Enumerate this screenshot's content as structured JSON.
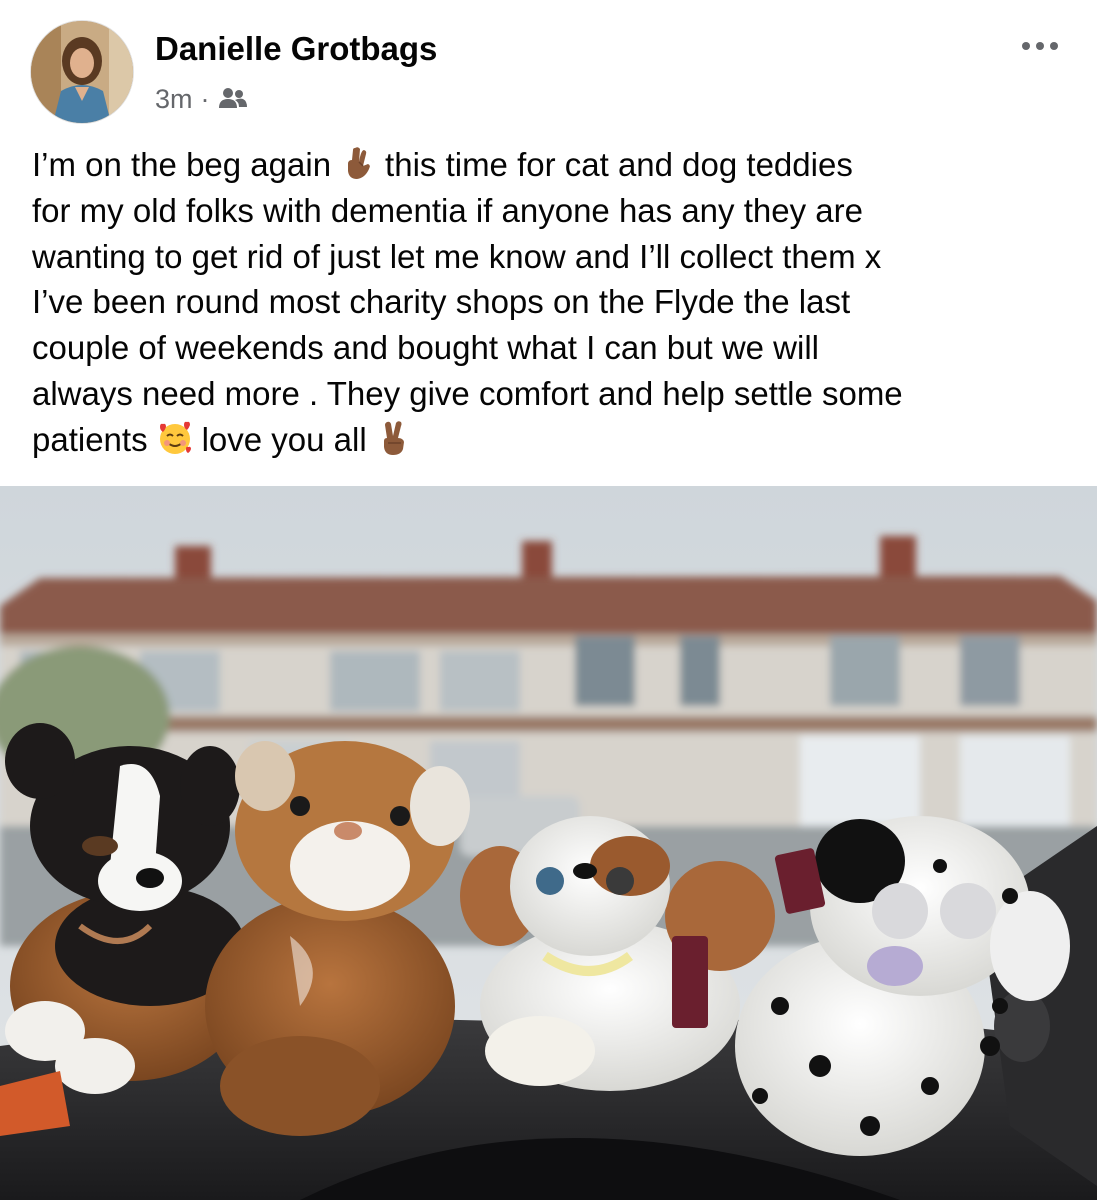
{
  "post": {
    "author": "Danielle Grotbags",
    "time": "3m",
    "separator": "·",
    "audience_icon": "friends-icon",
    "more_icon": "more-options-icon",
    "text": {
      "line1_a": "I’m on the beg again",
      "line1_b": "this time for cat and dog teddies",
      "line2": "for my old folks with dementia if anyone has any they are",
      "line3": "wanting to get rid of just let me know and I’ll collect them x",
      "line4": "I’ve been round most charity shops on the Flyde the last",
      "line5": "couple of weekends and bought what I can but we will",
      "line6": "always need more . They give comfort and help settle some",
      "line7_a": "patients",
      "line7_b": "love you all"
    },
    "emojis": [
      "crossed-fingers-emoji",
      "smiling-face-with-hearts-emoji",
      "victory-hand-emoji"
    ]
  },
  "colors": {
    "name": "#050505",
    "meta": "#65676b",
    "background": "#ffffff"
  }
}
